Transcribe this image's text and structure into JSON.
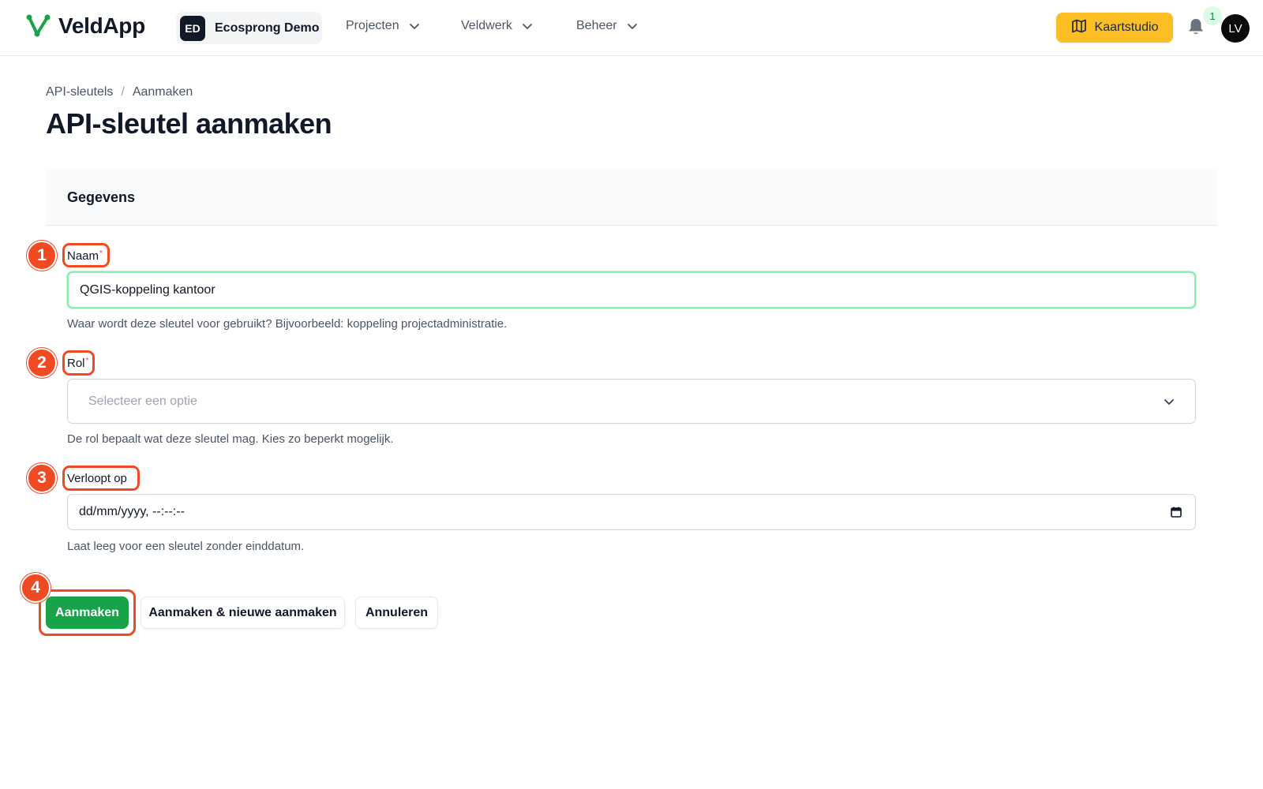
{
  "app": {
    "name": "VeldApp",
    "tenant_initials": "ED",
    "tenant_name": "Ecosprong Demo",
    "nav": [
      {
        "label": "Projecten"
      },
      {
        "label": "Veldwerk"
      },
      {
        "label": "Beheer"
      }
    ],
    "map_button_label": "Kaartstudio",
    "notification_count": "1",
    "user_initials": "LV"
  },
  "breadcrumb": [
    "API-sleutels",
    "Aanmaken"
  ],
  "page_title": "API-sleutel aanmaken",
  "section_title": "Gegevens",
  "fields": {
    "name": {
      "label": "Naam",
      "required_mark": "*",
      "value": "QGIS-koppeling kantoor",
      "hint": "Waar wordt deze sleutel voor gebruikt? Bijvoorbeeld: koppeling projectadministratie."
    },
    "role": {
      "label": "Rol",
      "required_mark": "*",
      "placeholder": "Selecteer een optie",
      "hint": "De rol bepaalt wat deze sleutel mag. Kies zo beperkt mogelijk."
    },
    "expires": {
      "label": "Verloopt op",
      "placeholder": "dd/mm/yyyy, --:--:--",
      "hint": "Laat leeg voor een sleutel zonder einddatum."
    }
  },
  "actions": {
    "create": "Aanmaken",
    "create_another": "Aanmaken & nieuwe aanmaken",
    "cancel": "Annuleren"
  },
  "annotations": [
    "1",
    "2",
    "3",
    "4"
  ],
  "colors": {
    "brand_green": "#16a34a",
    "map_button": "#fbbf24",
    "annotation": "#f04a23",
    "focus_ring": "#86efac"
  }
}
